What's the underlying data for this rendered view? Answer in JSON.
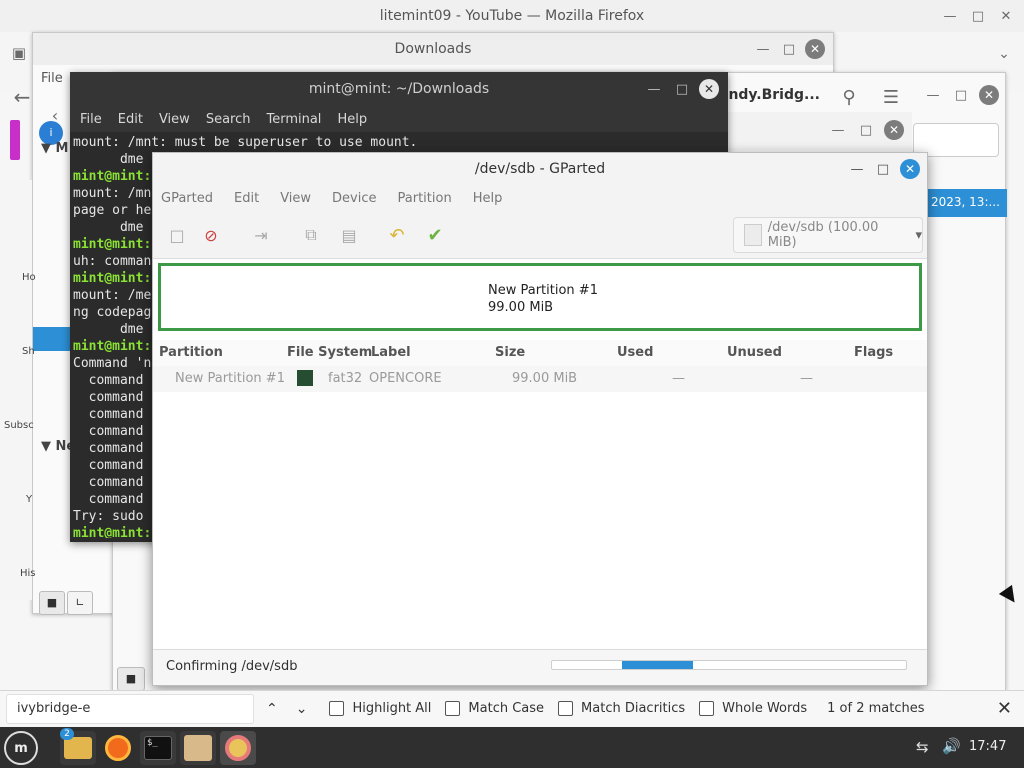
{
  "firefox": {
    "title": "litemint09 - YouTube — Mozilla Firefox",
    "tab_partial": "andy.Bridg...",
    "file_menu": "File",
    "find_bar": {
      "query": "ivybridge-e",
      "highlight_all": "Highlight All",
      "match_case": "Match Case",
      "match_diacritics": "Match Diacritics",
      "whole_words": "Whole Words",
      "result": "1 of 2 matches"
    }
  },
  "downloads": {
    "title": "Downloads",
    "sidebar_labels": [
      "M",
      "Ne"
    ],
    "side_texts": [
      "Ho",
      "Sh",
      "Subsc",
      "Y",
      "His"
    ],
    "file_date": "2023, 13:..."
  },
  "terminal": {
    "title": "mint@mint: ~/Downloads",
    "menu": [
      "File",
      "Edit",
      "View",
      "Search",
      "Terminal",
      "Help"
    ],
    "lines": [
      {
        "t": "mount: /mnt: must be superuser to use mount.",
        "p": false
      },
      {
        "t": "      dme",
        "p": false
      },
      {
        "t": "mint@mint:",
        "p": true
      },
      {
        "t": "mount: /mn",
        "p": false
      },
      {
        "t": "page or he",
        "p": false
      },
      {
        "t": "      dme",
        "p": false
      },
      {
        "t": "mint@mint:",
        "p": true
      },
      {
        "t": "uh: comman",
        "p": false
      },
      {
        "t": "mint@mint:",
        "p": true
      },
      {
        "t": "mount: /me",
        "p": false
      },
      {
        "t": "ng codepag",
        "p": false
      },
      {
        "t": "      dme",
        "p": false
      },
      {
        "t": "mint@mint:",
        "p": true
      },
      {
        "t": "Command 'n",
        "p": false
      },
      {
        "t": "  command",
        "p": false
      },
      {
        "t": "  command",
        "p": false
      },
      {
        "t": "  command",
        "p": false
      },
      {
        "t": "  command",
        "p": false
      },
      {
        "t": "  command",
        "p": false
      },
      {
        "t": "  command",
        "p": false
      },
      {
        "t": "  command",
        "p": false
      },
      {
        "t": "  command",
        "p": false
      },
      {
        "t": "Try: sudo",
        "p": false
      },
      {
        "t": "mint@mint:",
        "p": true
      }
    ]
  },
  "gparted": {
    "title": "/dev/sdb - GParted",
    "menu": [
      "GParted",
      "Edit",
      "View",
      "Device",
      "Partition",
      "Help"
    ],
    "device": "/dev/sdb (100.00 MiB)",
    "map_name": "New Partition #1",
    "map_size": "99.00 MiB",
    "columns": {
      "partition": "Partition",
      "filesystem": "File System",
      "label": "Label",
      "size": "Size",
      "used": "Used",
      "unused": "Unused",
      "flags": "Flags"
    },
    "row": {
      "partition": "New Partition #1",
      "filesystem": "fat32",
      "label": "OPENCORE",
      "size": "99.00 MiB",
      "used": "—",
      "unused": "—",
      "fs_color": "#264d32"
    },
    "status": "Confirming /dev/sdb",
    "progress": 0.2
  },
  "taskbar": {
    "clock": "17:47",
    "files_badge": "2",
    "terminal_glyph": "$_"
  }
}
